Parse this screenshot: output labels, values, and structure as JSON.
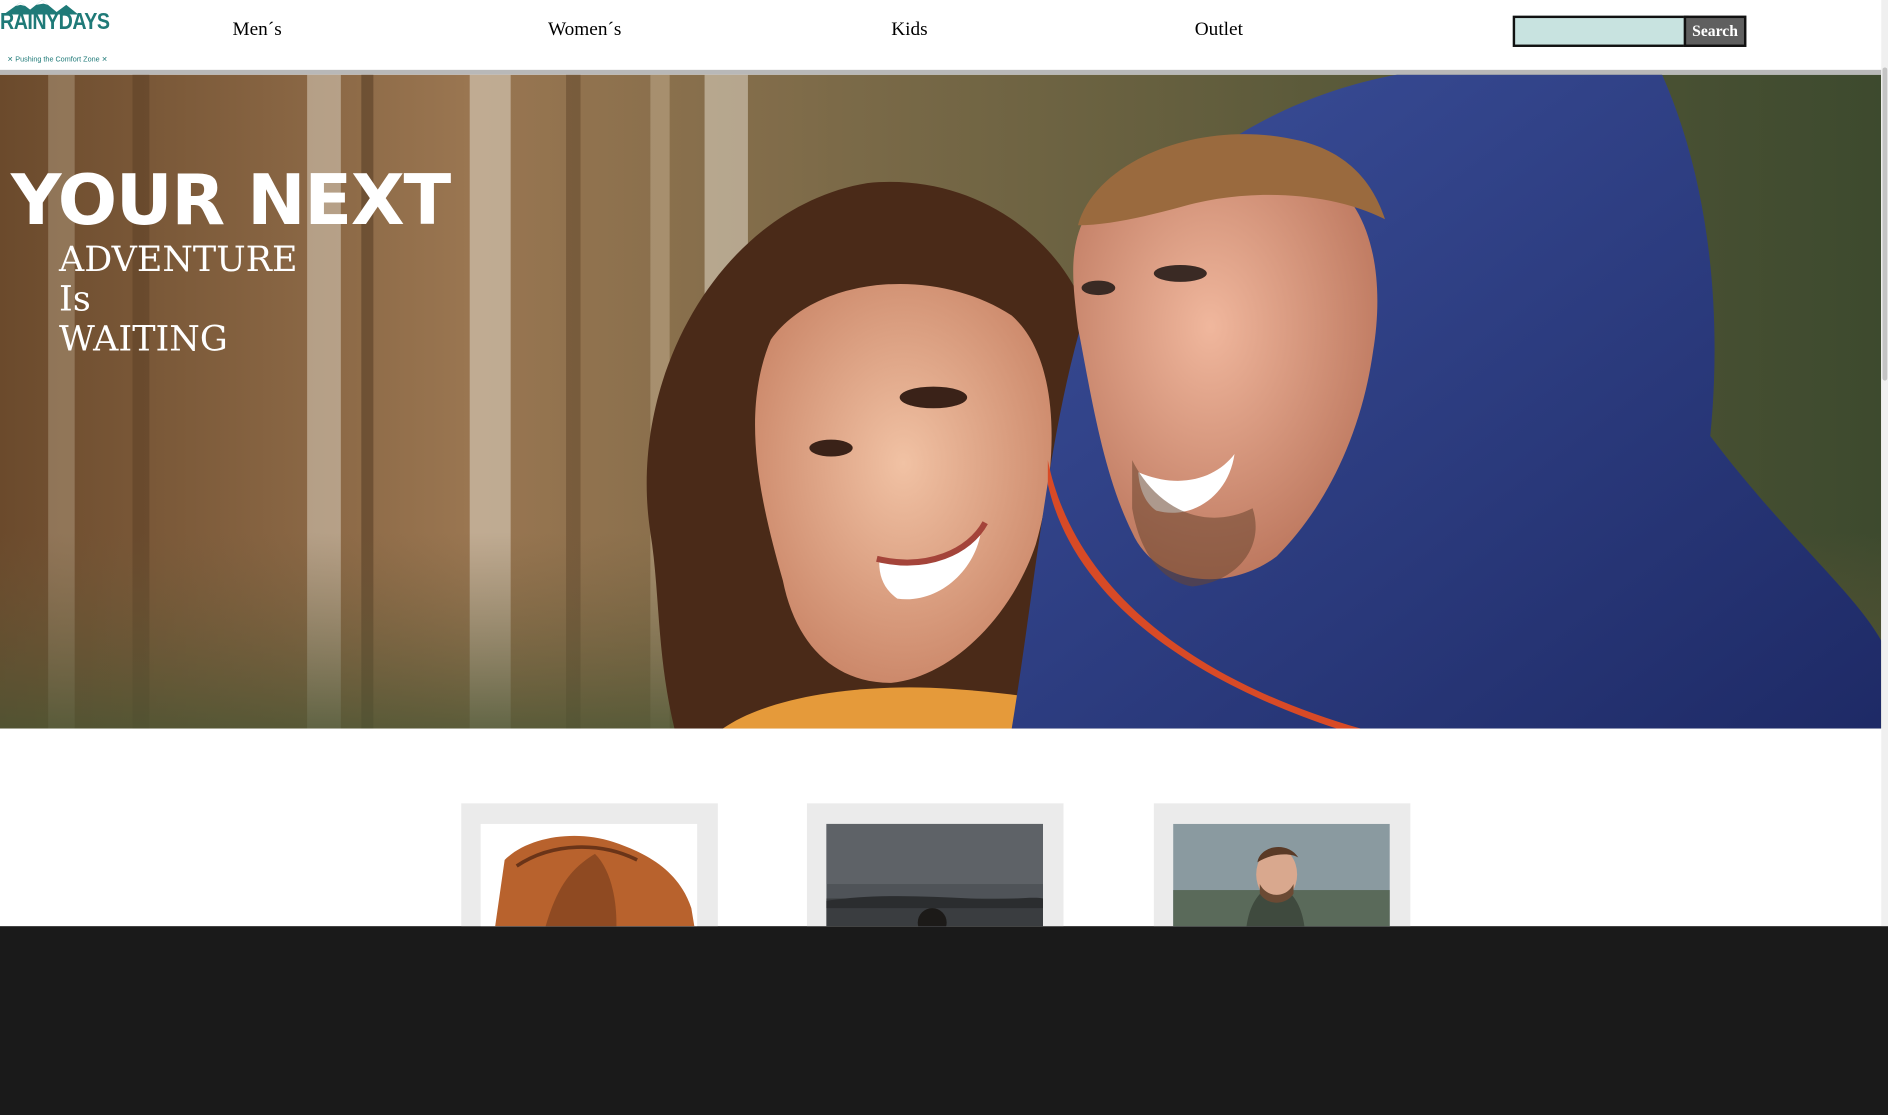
{
  "brand": {
    "name": "RAINYDAYS",
    "tagline": "✕ Pushing the Comfort Zone ✕",
    "color": "#1f7a78"
  },
  "nav": {
    "items": [
      {
        "label": "Men´s"
      },
      {
        "label": "Women´s"
      },
      {
        "label": "Kids"
      },
      {
        "label": "Outlet"
      }
    ]
  },
  "search": {
    "value": "",
    "placeholder": "",
    "button_label": "Search",
    "field_color": "#c8e3e0"
  },
  "hero": {
    "title": "YOUR NEXT",
    "line1": "ADVENTURE",
    "line2": "Is",
    "line3": "WAITING"
  },
  "products": [
    {
      "name": "brown-leather-jacket"
    },
    {
      "name": "person-by-lake-dark-sky"
    },
    {
      "name": "man-outdoors-portrait"
    }
  ]
}
